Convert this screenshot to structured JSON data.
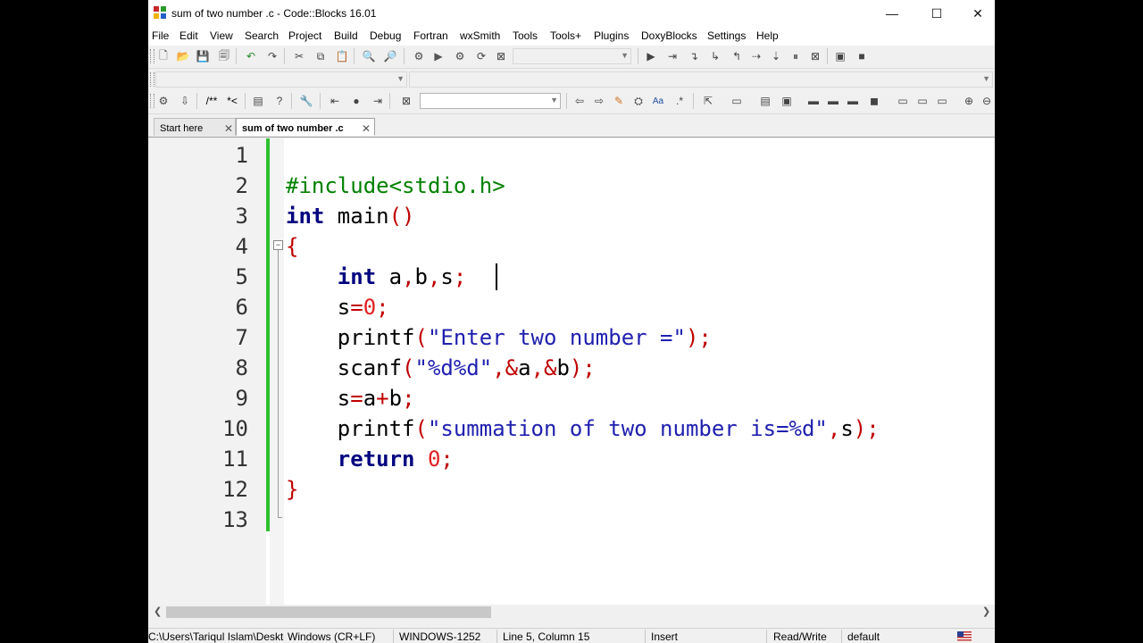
{
  "window": {
    "title": "sum of two number .c - Code::Blocks 16.01",
    "min_glyph": "—",
    "max_glyph": "☐",
    "close_glyph": "✕"
  },
  "menu": [
    "File",
    "Edit",
    "View",
    "Search",
    "Project",
    "Build",
    "Debug",
    "Fortran",
    "wxSmith",
    "Tools",
    "Tools+",
    "Plugins",
    "DoxyBlocks",
    "Settings",
    "Help"
  ],
  "toolbar": {
    "comment_label": "/**",
    "doxy_label": "*<"
  },
  "tabs": [
    {
      "label": "Start here",
      "active": false
    },
    {
      "label": "sum of two number .c",
      "active": true
    }
  ],
  "editor": {
    "line_numbers": [
      "1",
      "2",
      "3",
      "4",
      "5",
      "6",
      "7",
      "8",
      "9",
      "10",
      "11",
      "12",
      "13"
    ],
    "lines": [
      [],
      [
        {
          "t": "#include<stdio.h>",
          "c": "pp"
        }
      ],
      [
        {
          "t": "int",
          "c": "kw"
        },
        {
          "t": " main",
          "c": "id"
        },
        {
          "t": "()",
          "c": "op"
        }
      ],
      [
        {
          "t": "{",
          "c": "op"
        }
      ],
      [
        {
          "t": "    ",
          "c": "id"
        },
        {
          "t": "int",
          "c": "kw"
        },
        {
          "t": " a",
          "c": "id"
        },
        {
          "t": ",",
          "c": "op"
        },
        {
          "t": "b",
          "c": "id"
        },
        {
          "t": ",",
          "c": "op"
        },
        {
          "t": "s",
          "c": "id"
        },
        {
          "t": ";",
          "c": "op"
        }
      ],
      [
        {
          "t": "    s",
          "c": "id"
        },
        {
          "t": "=",
          "c": "op"
        },
        {
          "t": "0",
          "c": "num"
        },
        {
          "t": ";",
          "c": "op"
        }
      ],
      [
        {
          "t": "    printf",
          "c": "id"
        },
        {
          "t": "(",
          "c": "op"
        },
        {
          "t": "\"Enter two number =\"",
          "c": "str"
        },
        {
          "t": ");",
          "c": "op"
        }
      ],
      [
        {
          "t": "    scanf",
          "c": "id"
        },
        {
          "t": "(",
          "c": "op"
        },
        {
          "t": "\"%d%d\"",
          "c": "str"
        },
        {
          "t": ",&",
          "c": "op"
        },
        {
          "t": "a",
          "c": "id"
        },
        {
          "t": ",&",
          "c": "op"
        },
        {
          "t": "b",
          "c": "id"
        },
        {
          "t": ");",
          "c": "op"
        }
      ],
      [
        {
          "t": "    s",
          "c": "id"
        },
        {
          "t": "=",
          "c": "op"
        },
        {
          "t": "a",
          "c": "id"
        },
        {
          "t": "+",
          "c": "op"
        },
        {
          "t": "b",
          "c": "id"
        },
        {
          "t": ";",
          "c": "op"
        }
      ],
      [
        {
          "t": "    printf",
          "c": "id"
        },
        {
          "t": "(",
          "c": "op"
        },
        {
          "t": "\"summation of two number is=%d\"",
          "c": "str"
        },
        {
          "t": ",",
          "c": "op"
        },
        {
          "t": "s",
          "c": "id"
        },
        {
          "t": ");",
          "c": "op"
        }
      ],
      [
        {
          "t": "    ",
          "c": "id"
        },
        {
          "t": "return",
          "c": "kw"
        },
        {
          "t": " ",
          "c": "id"
        },
        {
          "t": "0",
          "c": "num"
        },
        {
          "t": ";",
          "c": "op"
        }
      ],
      [
        {
          "t": "}",
          "c": "op"
        }
      ],
      []
    ],
    "cursor_line": 5
  },
  "status": {
    "path": "C:\\Users\\Tariqul Islam\\Deskto",
    "eol": "Windows (CR+LF)",
    "encoding": "WINDOWS-1252",
    "position": "Line 5, Column 15",
    "mode": "Insert",
    "access": "Read/Write",
    "profile": "default",
    "flag": "US"
  },
  "colors": {
    "keyword": "#00007f",
    "preprocessor": "#008000",
    "operator": "#c00000",
    "number": "#e02020",
    "string": "#2020b0",
    "change_bar": "#2ec12e"
  }
}
